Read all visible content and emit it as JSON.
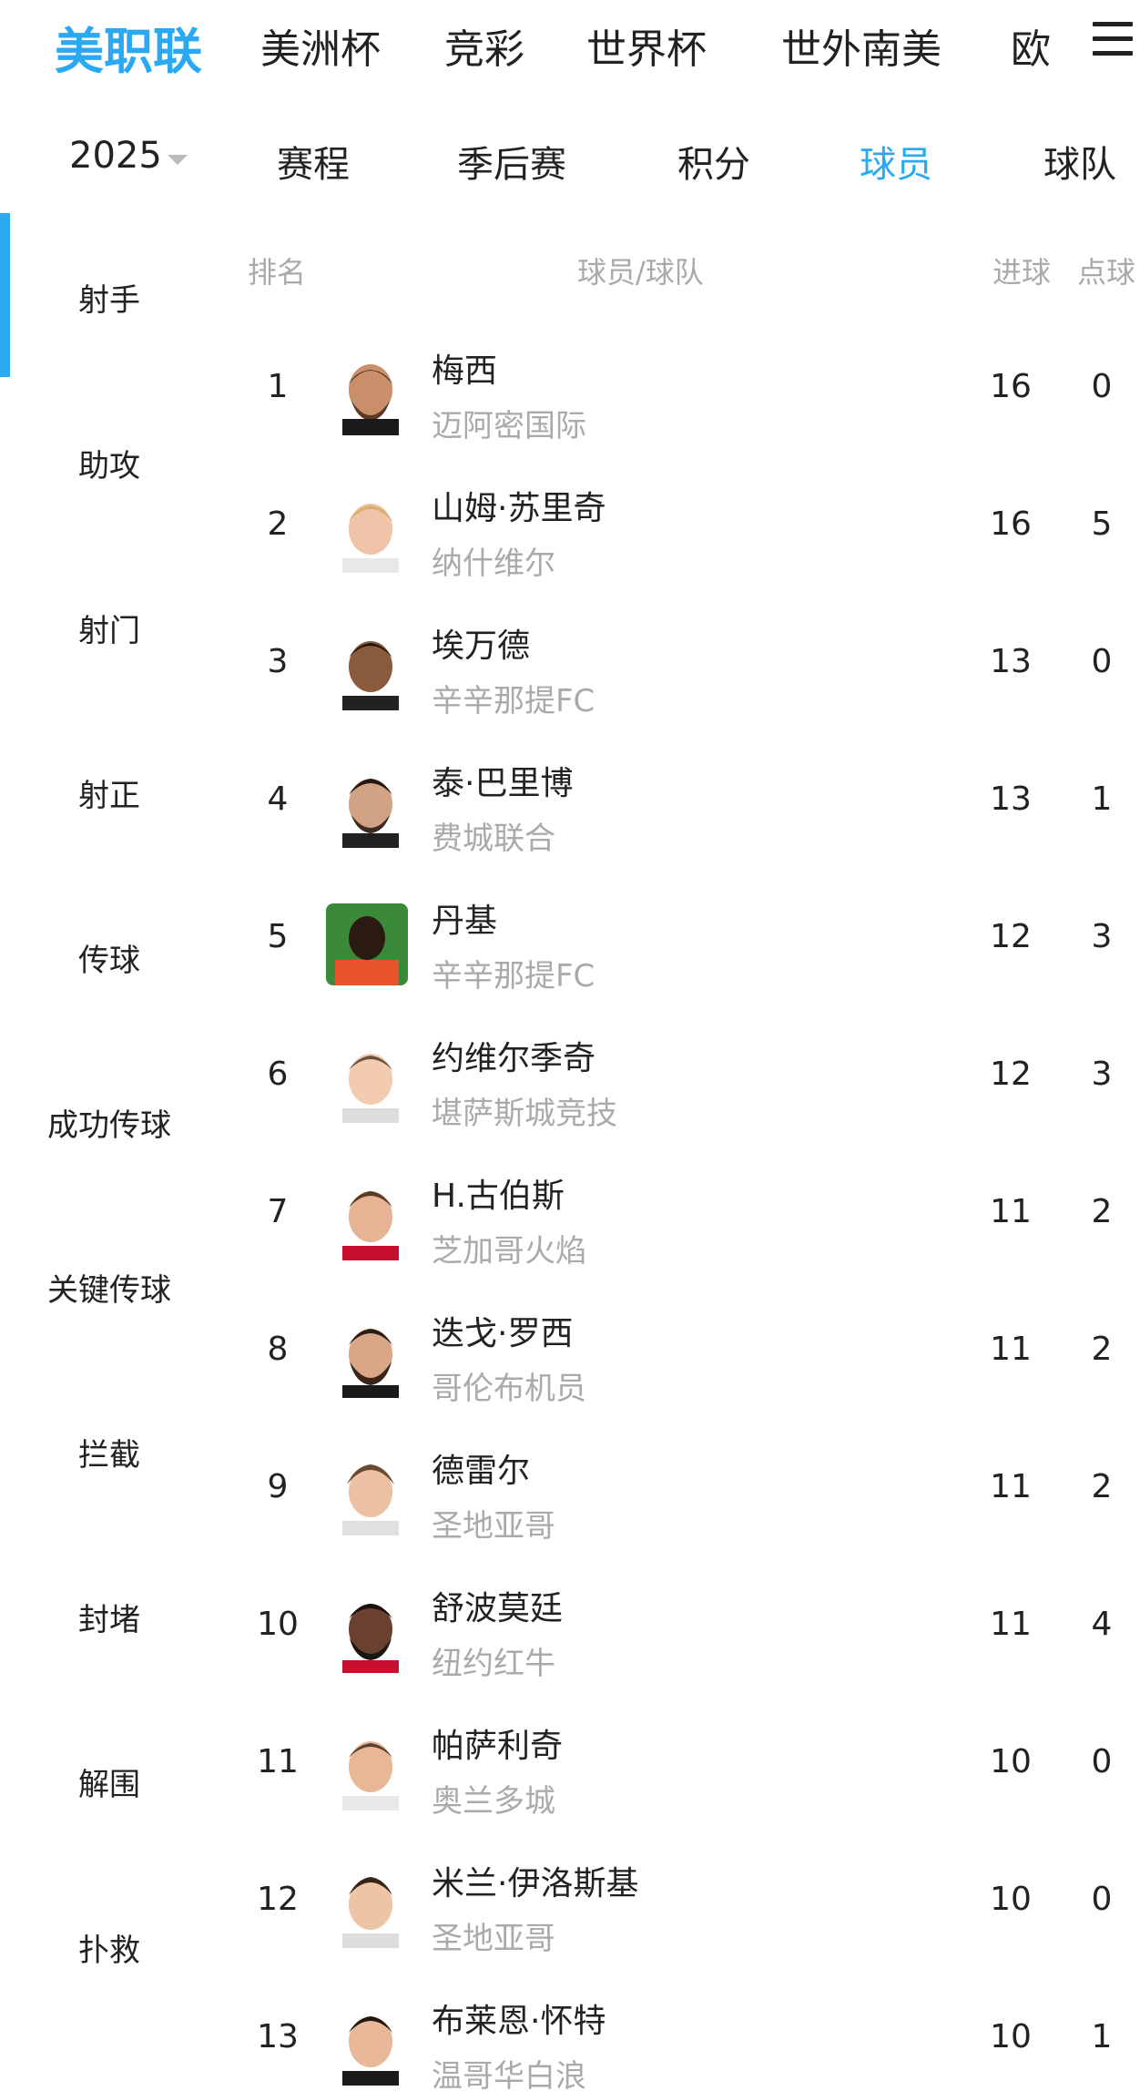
{
  "top_nav": {
    "items": [
      "美职联",
      "美洲杯",
      "竞彩",
      "世界杯",
      "世外南美",
      "欧"
    ],
    "active_index": 0
  },
  "sub_nav": {
    "year": "2025",
    "tabs": [
      "赛程",
      "季后赛",
      "积分",
      "球员",
      "球队"
    ],
    "active_index": 3
  },
  "sidebar": {
    "items": [
      "射手",
      "助攻",
      "射门",
      "射正",
      "传球",
      "成功传球",
      "关键传球",
      "拦截",
      "封堵",
      "解围",
      "扑救"
    ],
    "active_index": 0
  },
  "table": {
    "headers": {
      "rank": "排名",
      "player_team": "球员/球队",
      "goals": "进球",
      "penalties": "点球"
    },
    "rows": [
      {
        "rank": "1",
        "name": "梅西",
        "team": "迈阿密国际",
        "goals": "16",
        "penalties": "0"
      },
      {
        "rank": "2",
        "name": "山姆·苏里奇",
        "team": "纳什维尔",
        "goals": "16",
        "penalties": "5"
      },
      {
        "rank": "3",
        "name": "埃万德",
        "team": "辛辛那提FC",
        "goals": "13",
        "penalties": "0"
      },
      {
        "rank": "4",
        "name": "泰·巴里博",
        "team": "费城联合",
        "goals": "13",
        "penalties": "1"
      },
      {
        "rank": "5",
        "name": "丹基",
        "team": "辛辛那提FC",
        "goals": "12",
        "penalties": "3"
      },
      {
        "rank": "6",
        "name": "约维尔季奇",
        "team": "堪萨斯城竞技",
        "goals": "12",
        "penalties": "3"
      },
      {
        "rank": "7",
        "name": "H.古伯斯",
        "team": "芝加哥火焰",
        "goals": "11",
        "penalties": "2"
      },
      {
        "rank": "8",
        "name": "迭戈·罗西",
        "team": "哥伦布机员",
        "goals": "11",
        "penalties": "2"
      },
      {
        "rank": "9",
        "name": "德雷尔",
        "team": "圣地亚哥",
        "goals": "11",
        "penalties": "2"
      },
      {
        "rank": "10",
        "name": "舒波莫廷",
        "team": "纽约红牛",
        "goals": "11",
        "penalties": "4"
      },
      {
        "rank": "11",
        "name": "帕萨利奇",
        "team": "奥兰多城",
        "goals": "10",
        "penalties": "0"
      },
      {
        "rank": "12",
        "name": "米兰·伊洛斯基",
        "team": "圣地亚哥",
        "goals": "10",
        "penalties": "0"
      },
      {
        "rank": "13",
        "name": "布莱恩·怀特",
        "team": "温哥华白浪",
        "goals": "10",
        "penalties": "1"
      }
    ]
  },
  "colors": {
    "accent": "#2aa8f2",
    "muted": "#aaaaaa",
    "text": "#222222"
  }
}
